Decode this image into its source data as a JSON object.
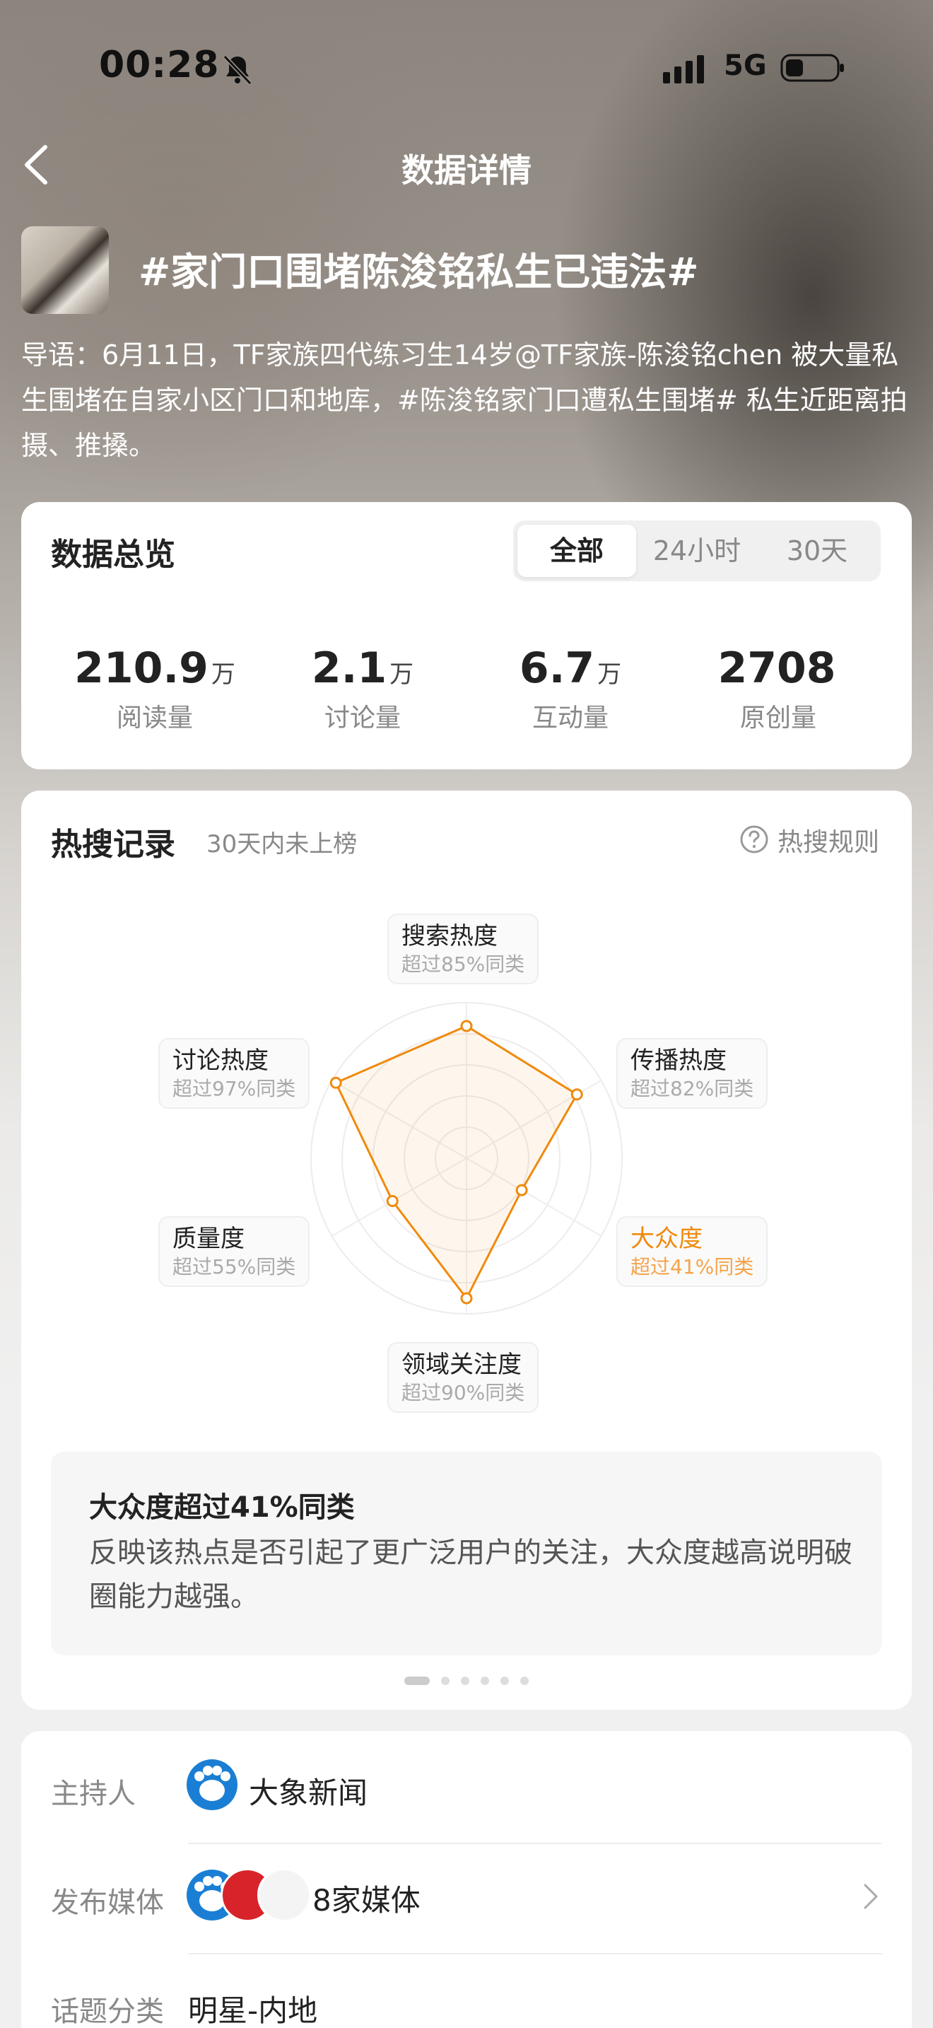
{
  "status_bar": {
    "time": "00:28",
    "network": "5G"
  },
  "nav": {
    "title": "数据详情"
  },
  "topic": {
    "title": "#家门口围堵陈浚铭私生已违法#",
    "intro": "导语：6月11日，TF家族四代练习生14岁@TF家族-陈浚铭chen 被大量私生围堵在自家小区门口和地库，#陈浚铭家门口遭私生围堵# 私生近距离拍摄、推搡。"
  },
  "overview": {
    "title": "数据总览",
    "tabs": [
      "全部",
      "24小时",
      "30天"
    ],
    "active_tab": "全部",
    "stats": [
      {
        "value": "210.9",
        "unit": "万",
        "label": "阅读量"
      },
      {
        "value": "2.1",
        "unit": "万",
        "label": "讨论量"
      },
      {
        "value": "6.7",
        "unit": "万",
        "label": "互动量"
      },
      {
        "value": "2708",
        "unit": "",
        "label": "原创量"
      }
    ]
  },
  "hot_search": {
    "title": "热搜记录",
    "subtitle": "30天内未上榜",
    "rules_label": "热搜规则",
    "radar": [
      {
        "name": "搜索热度",
        "detail": "超过85%同类",
        "percent": 85
      },
      {
        "name": "传播热度",
        "detail": "超过82%同类",
        "percent": 82
      },
      {
        "name": "大众度",
        "detail": "超过41%同类",
        "percent": 41,
        "highlighted": true
      },
      {
        "name": "领域关注度",
        "detail": "超过90%同类",
        "percent": 90
      },
      {
        "name": "质量度",
        "detail": "超过55%同类",
        "percent": 55
      },
      {
        "name": "讨论热度",
        "detail": "超过97%同类",
        "percent": 97
      }
    ],
    "radar_color": "#f08a0e",
    "description_title": "大众度超过41%同类",
    "description": "反映该热点是否引起了更广泛用户的关注，大众度越高说明破圈能力越强。",
    "page_count": 6,
    "active_page": 0
  },
  "info": {
    "host_label": "主持人",
    "host_name": "大象新闻",
    "media_label": "发布媒体",
    "media_count": "8家媒体",
    "category_label": "话题分类",
    "category": "明星-内地"
  }
}
